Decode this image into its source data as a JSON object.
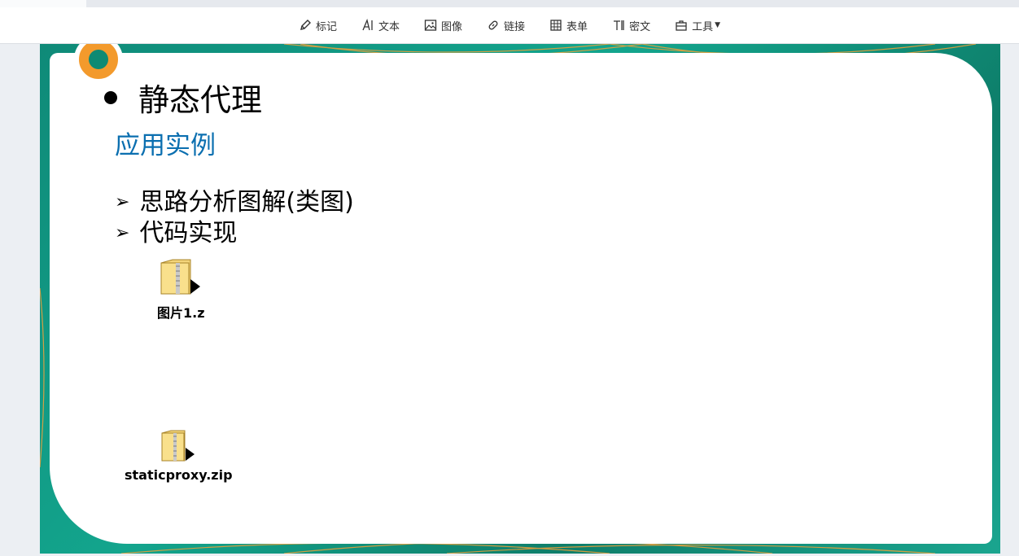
{
  "toolbar": {
    "items": [
      {
        "label": "标记",
        "icon": "pen-icon"
      },
      {
        "label": "文本",
        "icon": "text-icon"
      },
      {
        "label": "图像",
        "icon": "image-icon"
      },
      {
        "label": "链接",
        "icon": "link-icon"
      },
      {
        "label": "表单",
        "icon": "table-icon"
      },
      {
        "label": "密文",
        "icon": "redact-icon"
      },
      {
        "label": "工具",
        "icon": "toolbox-icon"
      }
    ]
  },
  "slide": {
    "heading": "静态代理",
    "subheading": "应用实例",
    "bullets": [
      "思路分析图解(类图)",
      "代码实现"
    ],
    "bullet_marker": "➢",
    "files": [
      {
        "name": "图片1.z",
        "icon": "zip-folder-icon"
      },
      {
        "name": "staticproxy.zip",
        "icon": "zip-folder-icon"
      }
    ],
    "colors": {
      "frame": "#13a58d",
      "accent_orange": "#f39a2c",
      "subheading": "#0b6fb0"
    }
  }
}
